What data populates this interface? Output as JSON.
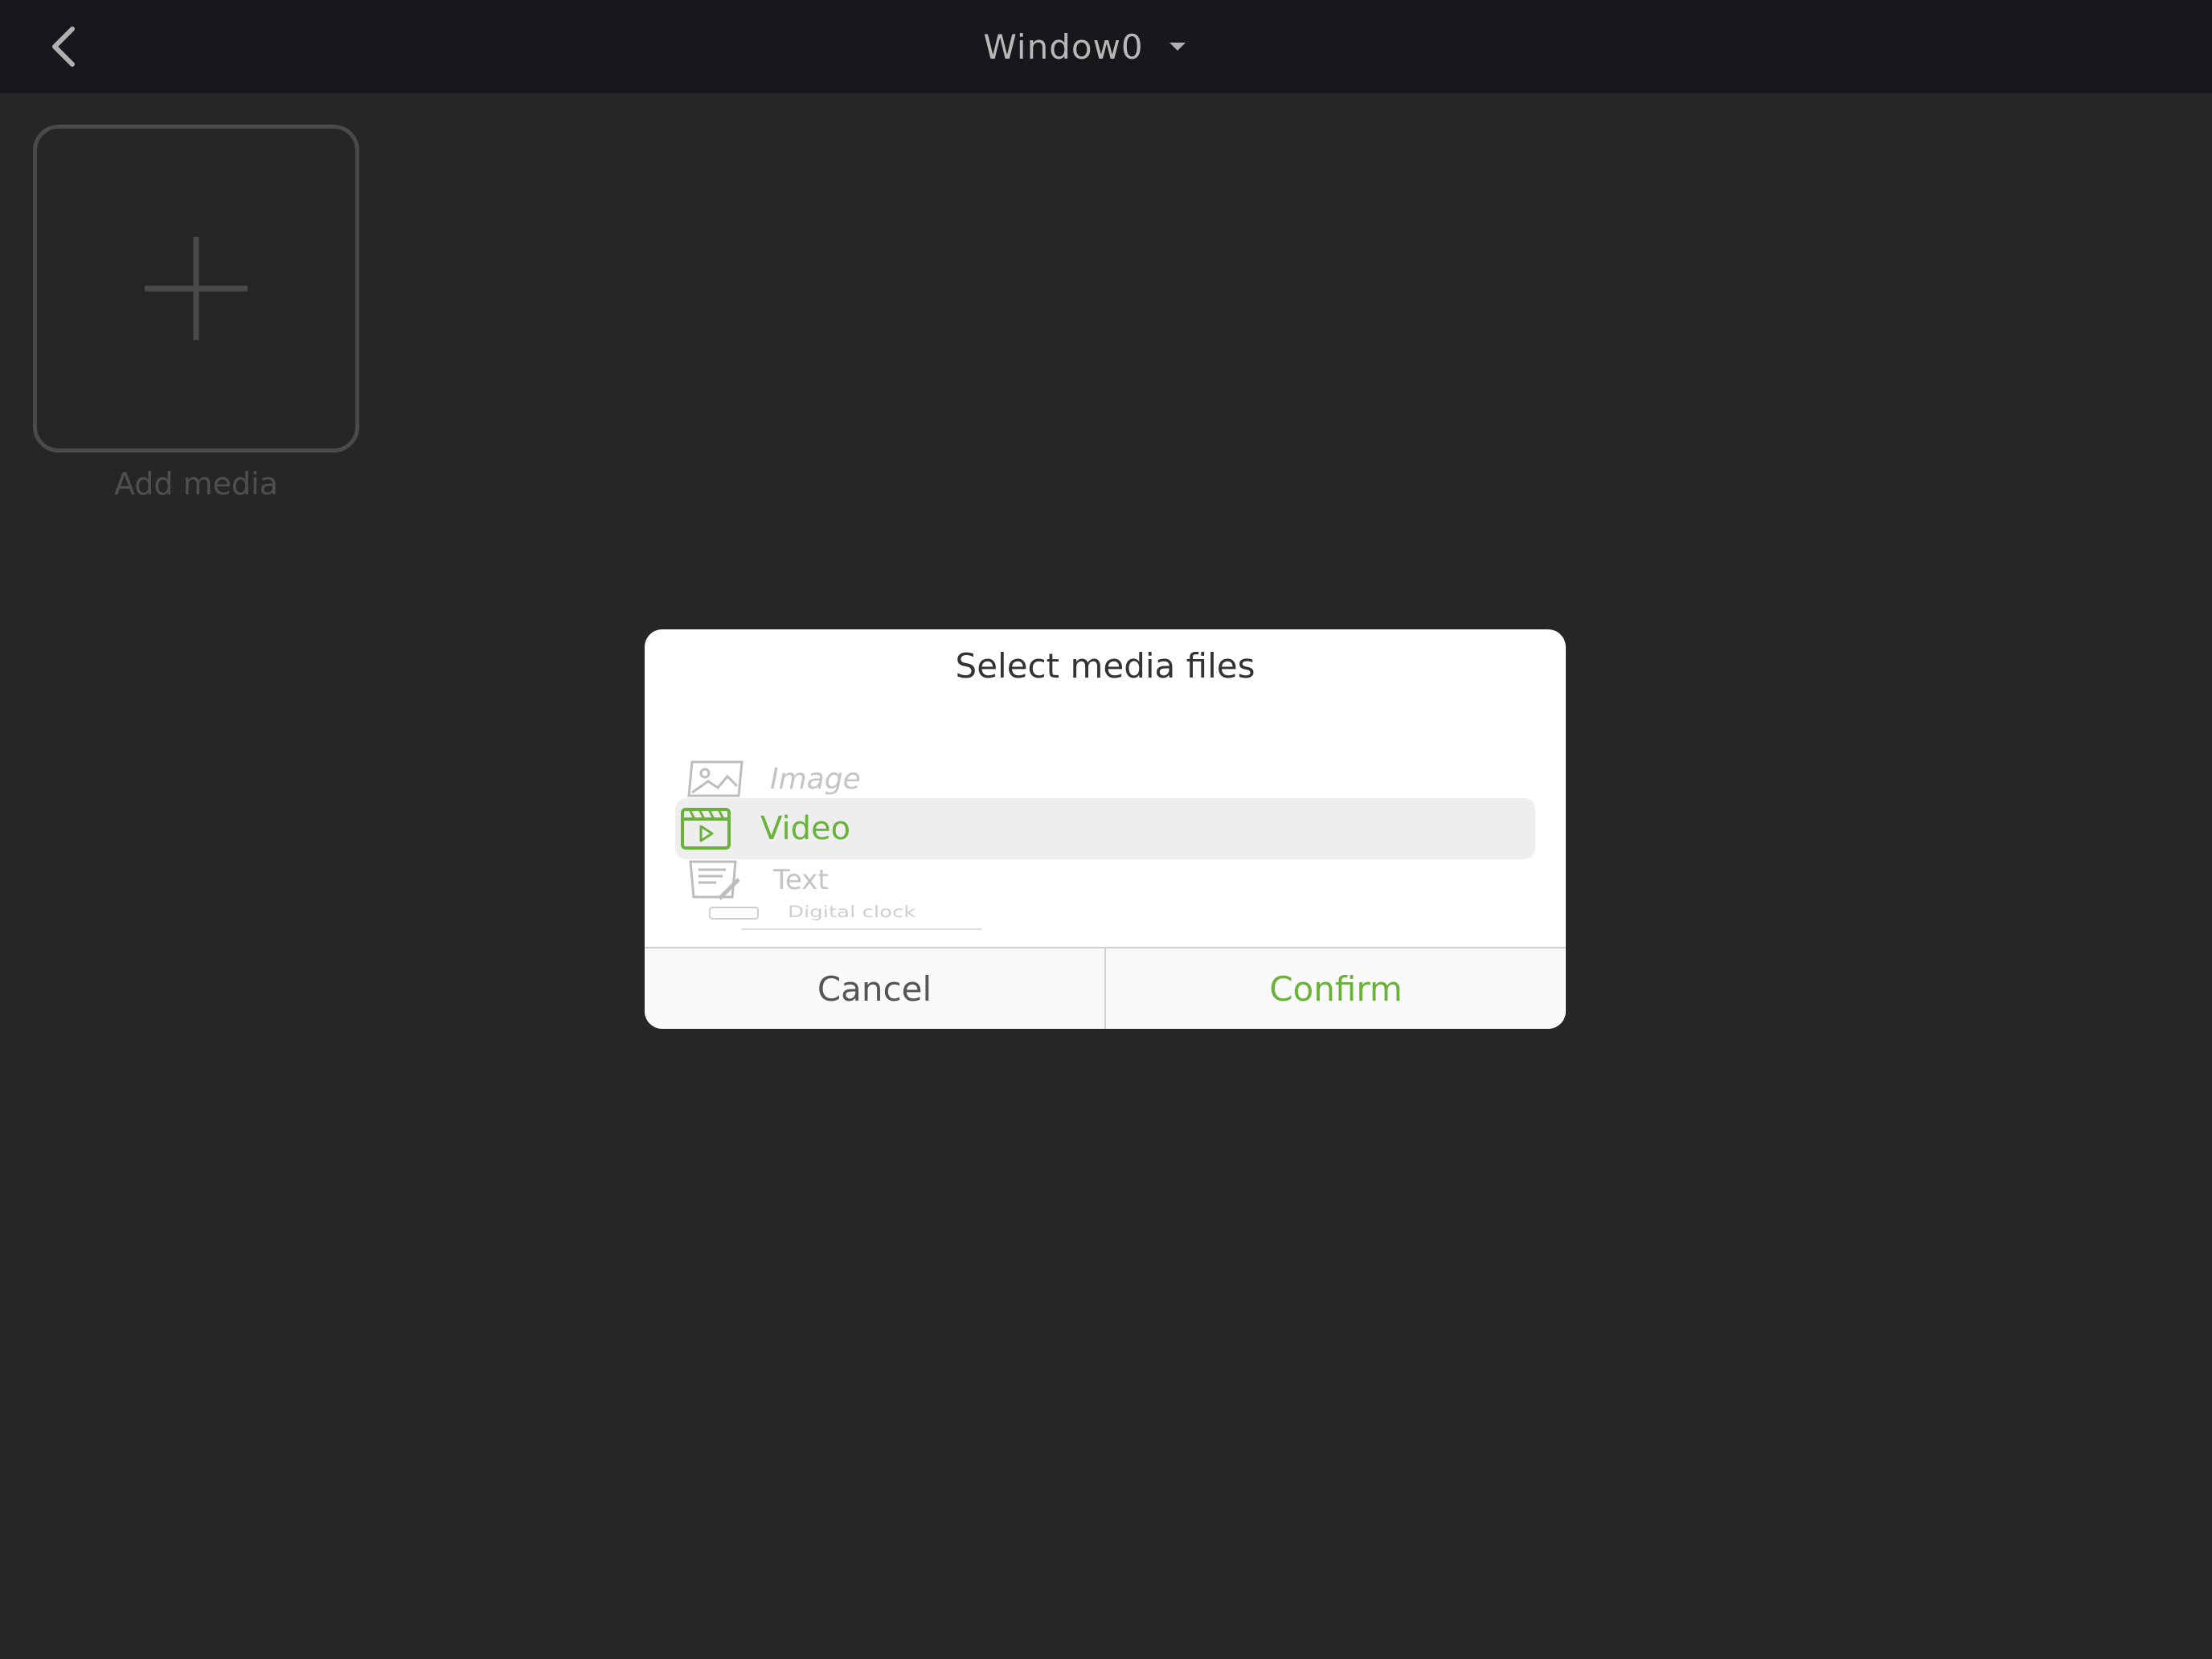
{
  "header": {
    "title": "Window0",
    "back_icon": "chevron-left-icon",
    "dropdown_icon": "caret-down-icon"
  },
  "media_area": {
    "add_label": "Add media",
    "add_icon": "plus-icon"
  },
  "dialog": {
    "title": "Select media files",
    "options": [
      {
        "label": "Image",
        "icon": "image-icon",
        "selected": false
      },
      {
        "label": "Video",
        "icon": "video-icon",
        "selected": true
      },
      {
        "label": "Text",
        "icon": "text-edit-icon",
        "selected": false
      },
      {
        "label": "Digital clock",
        "icon": "clock-icon",
        "selected": false
      }
    ],
    "cancel_label": "Cancel",
    "confirm_label": "Confirm"
  },
  "colors": {
    "accent": "#6ab23b",
    "background": "#262626",
    "topbar": "#17181b"
  }
}
